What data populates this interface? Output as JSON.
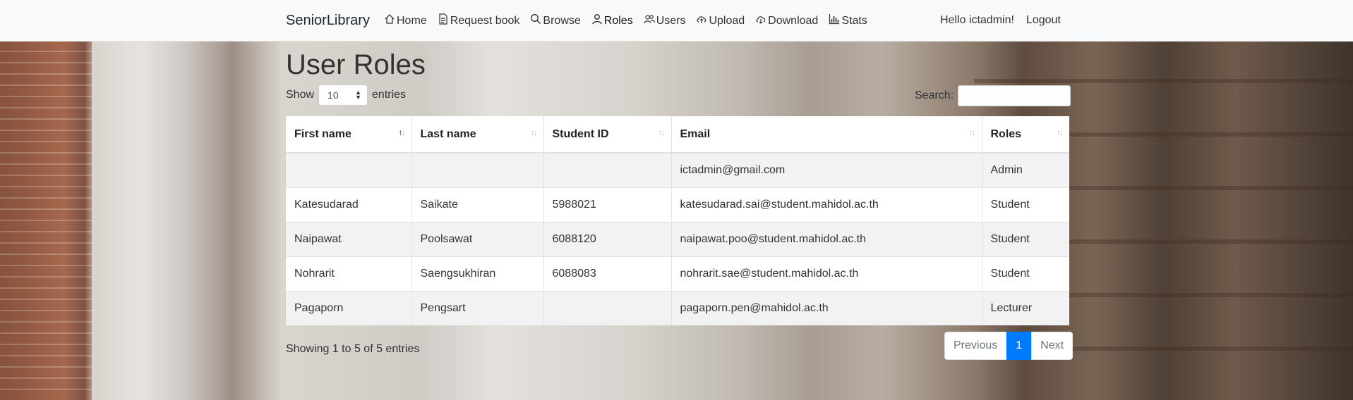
{
  "app": {
    "brand": "SeniorLibrary"
  },
  "nav": {
    "items": [
      {
        "label": "Home",
        "icon": "home-icon"
      },
      {
        "label": "Request book",
        "icon": "document-icon"
      },
      {
        "label": "Browse",
        "icon": "search-icon"
      },
      {
        "label": "Roles",
        "icon": "user-icon"
      },
      {
        "label": "Users",
        "icon": "users-icon"
      },
      {
        "label": "Upload",
        "icon": "cloud-upload-icon"
      },
      {
        "label": "Download",
        "icon": "cloud-download-icon"
      },
      {
        "label": "Stats",
        "icon": "bar-chart-icon"
      }
    ],
    "greeting": "Hello ictadmin!",
    "logout": "Logout"
  },
  "page": {
    "title": "User Roles",
    "show_label": "Show",
    "entries_label": "entries",
    "page_length": "10",
    "search_label": "Search:",
    "search_value": ""
  },
  "table": {
    "columns": [
      "First name",
      "Last name",
      "Student ID",
      "Email",
      "Roles"
    ],
    "rows": [
      {
        "first": "",
        "last": "",
        "student_id": "",
        "email": "ictadmin@gmail.com",
        "role": "Admin"
      },
      {
        "first": "Katesudarad",
        "last": "Saikate",
        "student_id": "5988021",
        "email": "katesudarad.sai@student.mahidol.ac.th",
        "role": "Student"
      },
      {
        "first": "Naipawat",
        "last": "Poolsawat",
        "student_id": "6088120",
        "email": "naipawat.poo@student.mahidol.ac.th",
        "role": "Student"
      },
      {
        "first": "Nohrarit",
        "last": "Saengsukhiran",
        "student_id": "6088083",
        "email": "nohrarit.sae@student.mahidol.ac.th",
        "role": "Student"
      },
      {
        "first": "Pagaporn",
        "last": "Pengsart",
        "student_id": "",
        "email": "pagaporn.pen@mahidol.ac.th",
        "role": "Lecturer"
      }
    ]
  },
  "footer": {
    "info": "Showing 1 to 5 of 5 entries",
    "prev": "Previous",
    "current": "1",
    "next": "Next"
  },
  "colors": {
    "accent": "#007bff",
    "navbar_bg": "#f8f9fa"
  }
}
